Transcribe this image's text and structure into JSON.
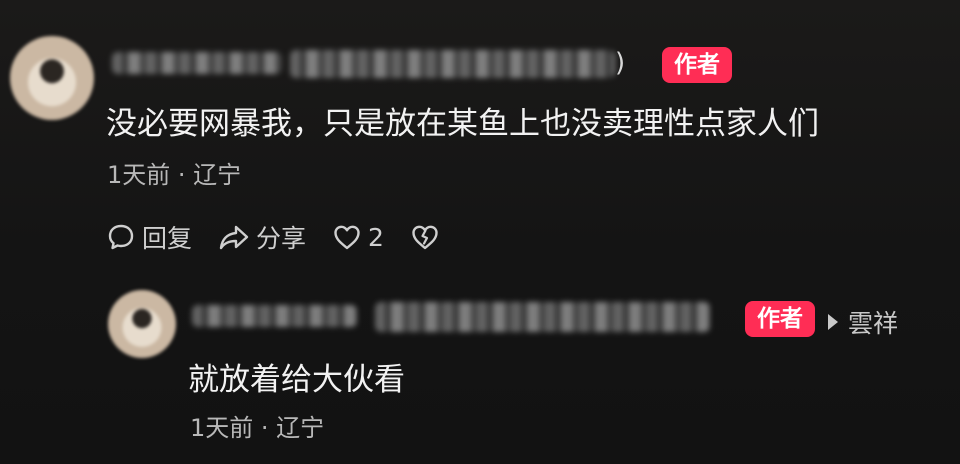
{
  "main_comment": {
    "paren_glyph": ")",
    "author_badge": "作者",
    "text": "没必要网暴我，只是放在某鱼上也没卖理性点家人们",
    "meta": "1天前 · 辽宁",
    "actions": {
      "reply_label": "回复",
      "share_label": "分享",
      "like_count": "2"
    }
  },
  "reply_comment": {
    "author_badge": "作者",
    "reply_to_name": "雲祥",
    "text": "就放着给大伙看",
    "meta": "1天前 · 辽宁"
  },
  "icons": {
    "reply": "chat-bubble-icon",
    "share": "share-arrow-icon",
    "like": "heart-icon",
    "dislike": "broken-heart-icon",
    "reply_to": "triangle-right-icon"
  },
  "colors": {
    "badge_bg": "#ff2d55",
    "text_primary": "#f2f2f2",
    "text_secondary": "#b8b8b8",
    "background": "#161616"
  }
}
